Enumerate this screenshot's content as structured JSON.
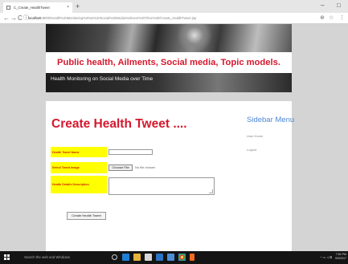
{
  "browser": {
    "tab_title": "C_Create_HealthTweet",
    "tab_close": "×",
    "new_tab": "+",
    "window_controls": {
      "minimize": "–",
      "restore": "□"
    },
    "nav": {
      "back": "←",
      "forward": "→",
      "reload": "C"
    },
    "url_host": "localhost",
    "url_path": ":8000/Health%20Monitoring%20on%20Social%20Media%20over%20Time%20/Create_HealthTweet.jsp"
  },
  "banner": {
    "title": "Public health, Ailments, Social media, Topic models.",
    "subtitle": "Health Monitoring on Social Media over Time"
  },
  "form": {
    "heading": "Create Health Tweet ....",
    "fields": [
      {
        "label": "Health Tweet Name"
      },
      {
        "label": "Select Tweet Image"
      },
      {
        "label": "Health Details Description"
      }
    ],
    "file_button": "Choose File",
    "file_status": "No file chosen",
    "submit": "Create Health Tweet"
  },
  "sidebar": {
    "title": "Sidebar Menu",
    "items": [
      "User Home",
      "Logout"
    ]
  },
  "taskbar": {
    "search_text": "Search the web and Windows",
    "tray_text": "^ ▭ ◁ ⌸",
    "clock_time": "7:50 PM",
    "clock_date": "9/9/2017"
  },
  "colors": {
    "accent_red": "#d5182e",
    "label_bg": "#ffff00",
    "sidebar_blue": "#4e87d6",
    "taskbar": "#141414"
  }
}
